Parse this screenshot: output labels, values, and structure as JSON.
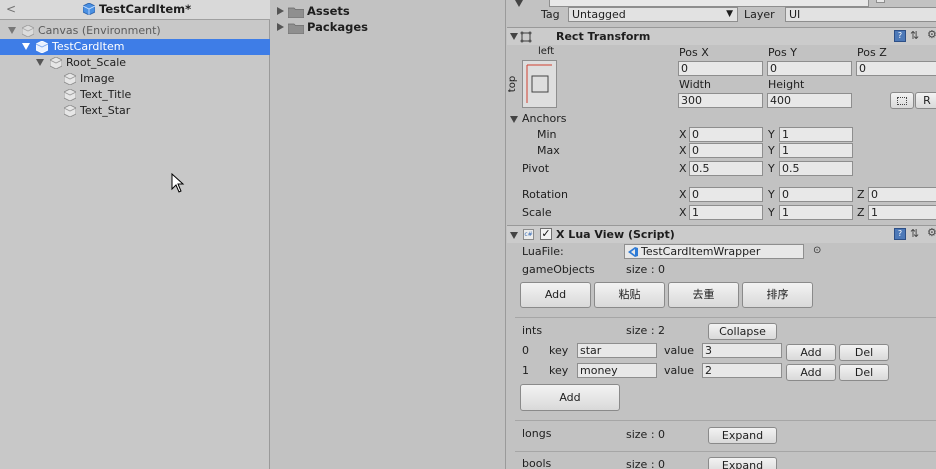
{
  "hierarchy": {
    "back_glyph": "<",
    "title": "TestCardItem*",
    "items": [
      {
        "label": "Canvas (Environment)"
      },
      {
        "label": "TestCardItem"
      },
      {
        "label": "Root_Scale"
      },
      {
        "label": "Image"
      },
      {
        "label": "Text_Title"
      },
      {
        "label": "Text_Star"
      }
    ]
  },
  "project": {
    "items": [
      {
        "label": "Assets"
      },
      {
        "label": "Packages"
      }
    ]
  },
  "inspector": {
    "tag_label": "Tag",
    "tag_value": "Untagged",
    "layer_label": "Layer",
    "layer_value": "UI",
    "rect_transform": {
      "title": "Rect Transform",
      "anchor_preset_top": "left",
      "anchor_preset_side": "top",
      "posx_label": "Pos X",
      "posy_label": "Pos Y",
      "posz_label": "Pos Z",
      "posx": "0",
      "posy": "0",
      "posz": "0",
      "width_label": "Width",
      "height_label": "Height",
      "width": "300",
      "height": "400",
      "raw_button": "R",
      "anchors_label": "Anchors",
      "min_label": "Min",
      "max_label": "Max",
      "pivot_label": "Pivot",
      "rotation_label": "Rotation",
      "scale_label": "Scale",
      "x_label": "X",
      "y_label": "Y",
      "z_label": "Z",
      "anchor_min_x": "0",
      "anchor_min_y": "1",
      "anchor_max_x": "0",
      "anchor_max_y": "1",
      "pivot_x": "0.5",
      "pivot_y": "0.5",
      "rotation_x": "0",
      "rotation_y": "0",
      "rotation_z": "0",
      "scale_x": "1",
      "scale_y": "1",
      "scale_z": "1"
    },
    "lua_view": {
      "script_badge": "c#",
      "title": "X Lua View (Script)",
      "enabled": true,
      "luafile_label": "LuaFile:",
      "luafile_value": "TestCardItemWrapper",
      "gameobjects_label": "gameObjects",
      "gameobjects_size": "size : 0",
      "buttons": {
        "add": "Add",
        "paste": "粘贴",
        "dedupe": "去重",
        "sort": "排序"
      },
      "ints_label": "ints",
      "ints_size": "size : 2",
      "collapse": "Collapse",
      "key_label": "key",
      "value_label": "value",
      "row_add": "Add",
      "row_del": "Del",
      "ints_rows": [
        {
          "index": "0",
          "key": "star",
          "value": "3"
        },
        {
          "index": "1",
          "key": "money",
          "value": "2"
        }
      ],
      "ints_add": "Add",
      "longs_label": "longs",
      "longs_size": "size : 0",
      "expand": "Expand",
      "bools_label": "bools",
      "bools_size": "size : 0"
    }
  },
  "colors": {
    "selection": "#3e7de7",
    "panel_bg": "#c2c2c2",
    "field_bg": "#e8e8e8"
  }
}
